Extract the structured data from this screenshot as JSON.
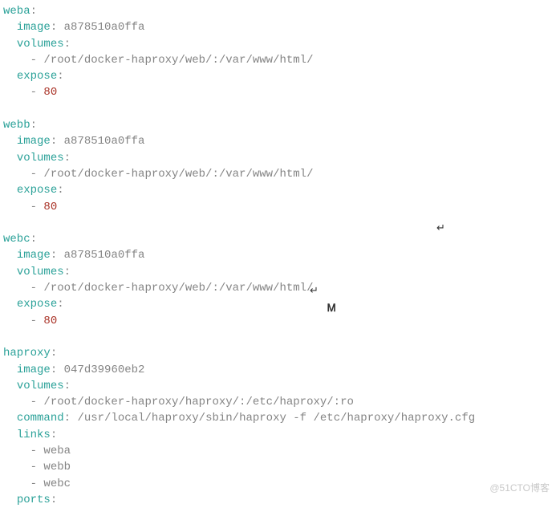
{
  "chart_data": {
    "type": "table",
    "title": "docker-compose YAML (haproxy + web workers)",
    "services": [
      {
        "name": "weba",
        "image": "a878510a0ffa",
        "volumes": [
          "/root/docker-haproxy/web/:/var/www/html/"
        ],
        "expose": [
          80
        ]
      },
      {
        "name": "webb",
        "image": "a878510a0ffa",
        "volumes": [
          "/root/docker-haproxy/web/:/var/www/html/"
        ],
        "expose": [
          80
        ]
      },
      {
        "name": "webc",
        "image": "a878510a0ffa",
        "volumes": [
          "/root/docker-haproxy/web/:/var/www/html/"
        ],
        "expose": [
          80
        ]
      },
      {
        "name": "haproxy",
        "image": "047d39960eb2",
        "volumes": [
          "/root/docker-haproxy/haproxy/:/etc/haproxy/:ro"
        ],
        "command": "/usr/local/haproxy/sbin/haproxy -f /etc/haproxy/haproxy.cfg",
        "links": [
          "weba",
          "webb",
          "webc"
        ],
        "ports": []
      }
    ]
  },
  "k": {
    "image": "image",
    "volumes": "volumes",
    "expose": "expose",
    "command": "command",
    "links": "links",
    "ports": "ports"
  },
  "s": {
    "web_vol": "/root/docker-haproxy/web/:/var/www/html/",
    "hap_vol": "/root/docker-haproxy/haproxy/:/etc/haproxy/:ro",
    "hap_cmd": "/usr/local/haproxy/sbin/haproxy -f /etc/haproxy/haproxy.cfg",
    "img_web": "a878510a0ffa",
    "img_hap": "047d39960eb2",
    "eighty": "80"
  },
  "n": {
    "weba": "weba",
    "webb": "webb",
    "webc": "webc",
    "haproxy": "haproxy"
  },
  "watermark": "@51CTO博客"
}
